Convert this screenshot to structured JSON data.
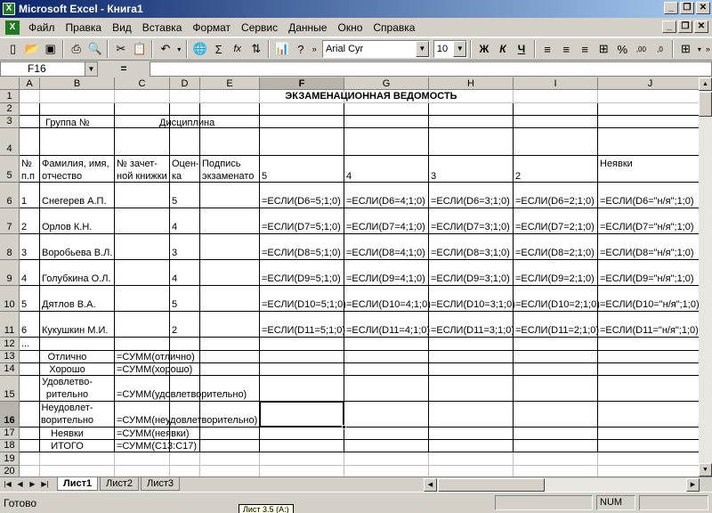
{
  "window": {
    "title": "Microsoft Excel - Книга1",
    "buttons": {
      "minimize": "_",
      "restore": "❐",
      "close": "✕"
    }
  },
  "menu": [
    "Файл",
    "Правка",
    "Вид",
    "Вставка",
    "Формат",
    "Сервис",
    "Данные",
    "Окно",
    "Справка"
  ],
  "toolbar": {
    "font_name": "Arial Cyr",
    "font_size": "10",
    "bold": "Ж",
    "italic": "К",
    "underline": "Ч",
    "sum_symbol": "Σ",
    "fx_symbol": "fx",
    "percent": "%",
    "increase_decimal": ",00",
    "decrease_decimal": ",0"
  },
  "formula_bar": {
    "name_box": "F16",
    "equals": "=",
    "value": ""
  },
  "columns": [
    "A",
    "B",
    "C",
    "D",
    "E",
    "F",
    "G",
    "H",
    "I",
    "J"
  ],
  "rows": [
    "1",
    "2",
    "3",
    "4",
    "5",
    "6",
    "7",
    "8",
    "9",
    "10",
    "11",
    "12",
    "13",
    "14",
    "15",
    "16",
    "17",
    "18",
    "19",
    "20",
    "21"
  ],
  "sheet": {
    "title": "ЭКЗАМЕНАЦИОННАЯ ВЕДОМОСТЬ",
    "group_label": "Группа №",
    "discipline_label": "Дисциплина",
    "headers": {
      "num_1": "№",
      "num_2": "п.п",
      "name_1": "Фамилия, имя,",
      "name_2": "отчество",
      "book_1": "№ зачет-",
      "book_2": "ной книжки",
      "grade_1": "Оцен-",
      "grade_2": "ка",
      "sign_1": "Подпись",
      "sign_2": "экзаменато",
      "f": "5",
      "g": "4",
      "h": "3",
      "i": "2",
      "j": "Неявки"
    },
    "students": [
      {
        "n": "1",
        "name": "Снегерев А.П.",
        "grade": "5",
        "f": "=ЕСЛИ(D6=5;1;0)",
        "g": "=ЕСЛИ(D6=4;1;0)",
        "h": "=ЕСЛИ(D6=3;1;0)",
        "i": "=ЕСЛИ(D6=2;1;0)",
        "j": "=ЕСЛИ(D6=\"н/я\";1;0)"
      },
      {
        "n": "2",
        "name": "Орлов К.Н.",
        "grade": "4",
        "f": "=ЕСЛИ(D7=5;1;0)",
        "g": "=ЕСЛИ(D7=4;1;0)",
        "h": "=ЕСЛИ(D7=3;1;0)",
        "i": "=ЕСЛИ(D7=2;1;0)",
        "j": "=ЕСЛИ(D7=\"н/я\";1;0)"
      },
      {
        "n": "3",
        "name": "Воробьева В.Л.",
        "grade": "3",
        "f": "=ЕСЛИ(D8=5;1;0)",
        "g": "=ЕСЛИ(D8=4;1;0)",
        "h": "=ЕСЛИ(D8=3;1;0)",
        "i": "=ЕСЛИ(D8=2;1;0)",
        "j": "=ЕСЛИ(D8=\"н/я\";1;0)"
      },
      {
        "n": "4",
        "name": "Голубкина О.Л.",
        "grade": "4",
        "f": "=ЕСЛИ(D9=5;1;0)",
        "g": "=ЕСЛИ(D9=4;1;0)",
        "h": "=ЕСЛИ(D9=3;1;0)",
        "i": "=ЕСЛИ(D9=2;1;0)",
        "j": "=ЕСЛИ(D9=\"н/я\";1;0)"
      },
      {
        "n": "5",
        "name": "Дятлов В.А.",
        "grade": "5",
        "f": "=ЕСЛИ(D10=5;1;0)",
        "g": "=ЕСЛИ(D10=4;1;0)",
        "h": "=ЕСЛИ(D10=3;1;0)",
        "i": "=ЕСЛИ(D10=2;1;0)",
        "j": "=ЕСЛИ(D10=\"н/я\";1;0)"
      },
      {
        "n": "6",
        "name": "Кукушкин М.И.",
        "grade": "2",
        "f": "=ЕСЛИ(D11=5;1;0)",
        "g": "=ЕСЛИ(D11=4;1;0)",
        "h": "=ЕСЛИ(D11=3;1;0)",
        "i": "=ЕСЛИ(D11=2;1;0)",
        "j": "=ЕСЛИ(D11=\"н/я\";1;0)"
      }
    ],
    "ellipsis": "...",
    "summary": {
      "excellent_label": "Отлично",
      "excellent_formula": "=СУММ(отлично)",
      "good_label": "Хорошо",
      "good_formula": "=СУММ(хорошо)",
      "satisf_label_1": "Удовлетво-",
      "satisf_label_2": "рительно",
      "satisf_formula": "=СУММ(удовлетворительно)",
      "unsatisf_label_1": "Неудовлет-",
      "unsatisf_label_2": "ворительно",
      "unsatisf_formula": "=СУММ(неудовлетворительно)",
      "absent_label": "Неявки",
      "absent_formula": "=СУММ(неявки)",
      "total_label": "ИТОГО",
      "total_formula": "=СУММ(C13:C17)"
    }
  },
  "sheet_tabs": [
    "Лист1",
    "Лист2",
    "Лист3"
  ],
  "tab_nav": [
    "|◀",
    "◀",
    "▶",
    "▶|"
  ],
  "status": {
    "text": "Готово",
    "num": "NUM",
    "tooltip": "Лист 3.5 (А:)"
  }
}
